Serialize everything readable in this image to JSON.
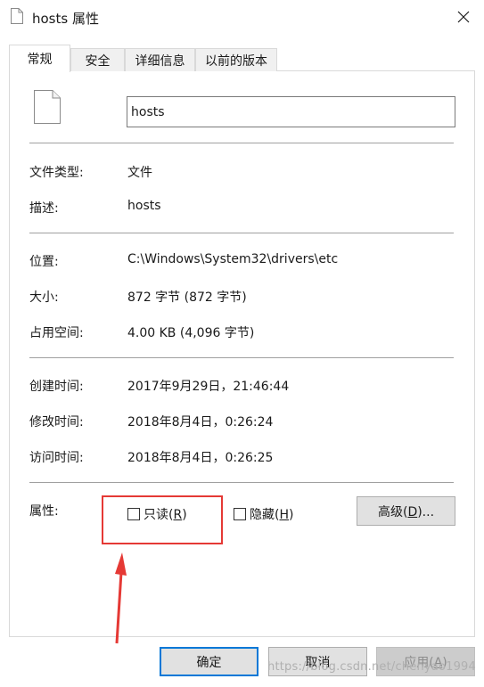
{
  "window": {
    "title": "hosts 属性",
    "title_icon": "file-icon",
    "close_icon": "close-icon"
  },
  "tabs": [
    {
      "label": "常规",
      "active": true
    },
    {
      "label": "安全",
      "active": false
    },
    {
      "label": "详细信息",
      "active": false
    },
    {
      "label": "以前的版本",
      "active": false
    }
  ],
  "general": {
    "file_name": "hosts",
    "file_type_label": "文件类型:",
    "file_type": "文件",
    "description_label": "描述:",
    "description": "hosts",
    "location_label": "位置:",
    "location": "C:\\Windows\\System32\\drivers\\etc",
    "size_label": "大小:",
    "size": "872 字节 (872 字节)",
    "size_on_disk_label": "占用空间:",
    "size_on_disk": "4.00 KB (4,096 字节)",
    "created_label": "创建时间:",
    "created": "2017年9月29日，21:46:44",
    "modified_label": "修改时间:",
    "modified": "2018年8月4日，0:26:24",
    "accessed_label": "访问时间:",
    "accessed": "2018年8月4日，0:26:25",
    "attributes_label": "属性:",
    "readonly": {
      "text": "只读(",
      "key": "R",
      "tail": ")",
      "checked": false
    },
    "hidden": {
      "text": "隐藏(",
      "key": "H",
      "tail": ")",
      "checked": false
    },
    "advanced": {
      "text": "高级(",
      "key": "D",
      "tail": ")..."
    }
  },
  "buttons": {
    "ok": "确定",
    "cancel": "取消",
    "apply": {
      "text": "应用(",
      "key": "A",
      "tail": ")"
    }
  },
  "annotation": {
    "color": "#e53935"
  },
  "watermark": "https://blog.csdn.net/chenyao1994",
  "colors": {
    "accent": "#0078d7"
  }
}
